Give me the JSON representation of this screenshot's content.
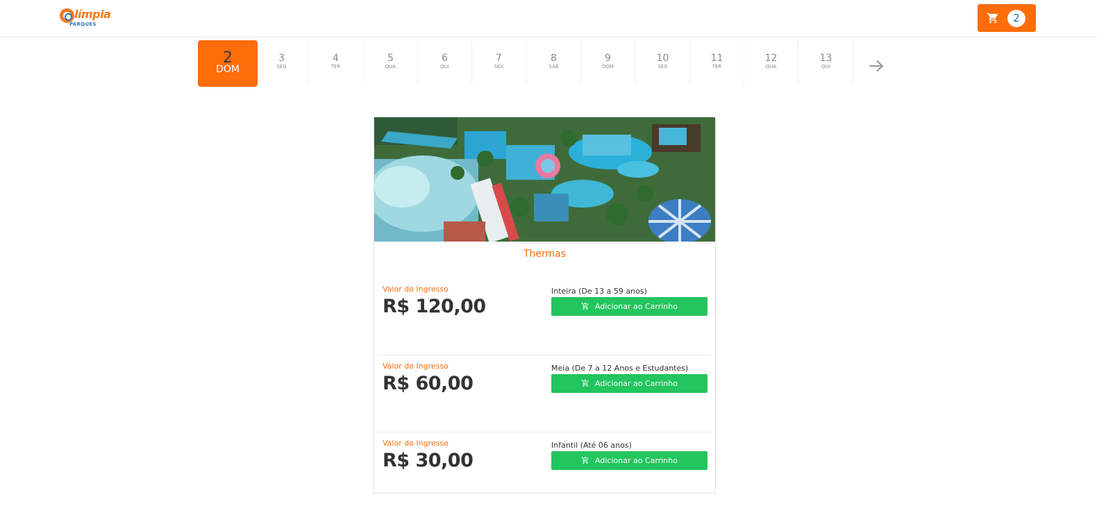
{
  "brand": {
    "logo_text": "límpia",
    "logo_sub": "PARQUES",
    "accent_color": "#ff6c0a",
    "secondary_color": "#2a7ab8",
    "success_color": "#22c55e"
  },
  "cart": {
    "icon": "cart-icon",
    "count": "2"
  },
  "dates": [
    {
      "day": "2",
      "weekday": "DOM",
      "active": true
    },
    {
      "day": "3",
      "weekday": "SEG"
    },
    {
      "day": "4",
      "weekday": "TER"
    },
    {
      "day": "5",
      "weekday": "QUA"
    },
    {
      "day": "6",
      "weekday": "QUI"
    },
    {
      "day": "7",
      "weekday": "SEX"
    },
    {
      "day": "8",
      "weekday": "SÁB"
    },
    {
      "day": "9",
      "weekday": "DOM"
    },
    {
      "day": "10",
      "weekday": "SEG"
    },
    {
      "day": "11",
      "weekday": "TER"
    },
    {
      "day": "12",
      "weekday": "QUA"
    },
    {
      "day": "13",
      "weekday": "QUI"
    }
  ],
  "next_icon": "arrow-right-icon",
  "product": {
    "title": "Thermas",
    "tickets": [
      {
        "label": "Valor do Ingresso",
        "price": "R$ 120,00",
        "type": "Inteira (De 13 a 59 anos)",
        "button": "Adicionar ao Carrinho"
      },
      {
        "label": "Valor do Ingresso",
        "price": "R$ 60,00",
        "type": "Meia (De 7 a 12 Anos e Estudantes)",
        "button": "Adicionar ao Carrinho"
      },
      {
        "label": "Valor do Ingresso",
        "price": "R$ 30,00",
        "type": "Infantil (Até 06 anos)",
        "button": "Adicionar ao Carrinho"
      }
    ]
  }
}
